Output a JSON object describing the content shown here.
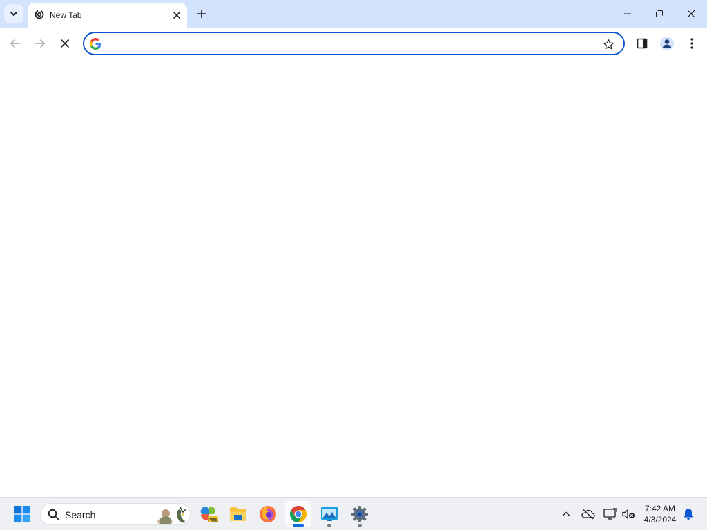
{
  "browser": {
    "tab": {
      "title": "New Tab"
    },
    "omnibox": {
      "value": "",
      "placeholder": ""
    }
  },
  "taskbar": {
    "search_label": "Search",
    "clock": {
      "time": "7:42 AM",
      "date": "4/3/2024"
    },
    "apps": [
      "windows-start",
      "copilot-pre",
      "file-explorer",
      "firefox",
      "chrome",
      "photos",
      "settings"
    ]
  },
  "colors": {
    "tabstrip_bg": "#d3e3fd",
    "omnibox_border": "#0b57d0",
    "taskbar_bg": "#eef0f3"
  }
}
